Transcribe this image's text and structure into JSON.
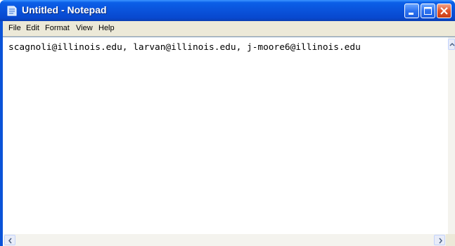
{
  "window": {
    "title": "Untitled - Notepad",
    "app_icon": "notepad-icon",
    "controls": [
      "minimize-icon",
      "maximize-icon",
      "close-icon"
    ]
  },
  "menu": {
    "items": [
      {
        "label": "File"
      },
      {
        "label": "Edit"
      },
      {
        "label": "Format"
      },
      {
        "label": "View"
      },
      {
        "label": "Help"
      }
    ]
  },
  "editor": {
    "text": "scagnoli@illinois.edu, larvan@illinois.edu, j-moore6@illinois.edu"
  },
  "colors": {
    "titlebar": "#0a54dc",
    "menubar": "#ece9d8",
    "close_button": "#e2542a",
    "editor_background": "#ffffff"
  }
}
